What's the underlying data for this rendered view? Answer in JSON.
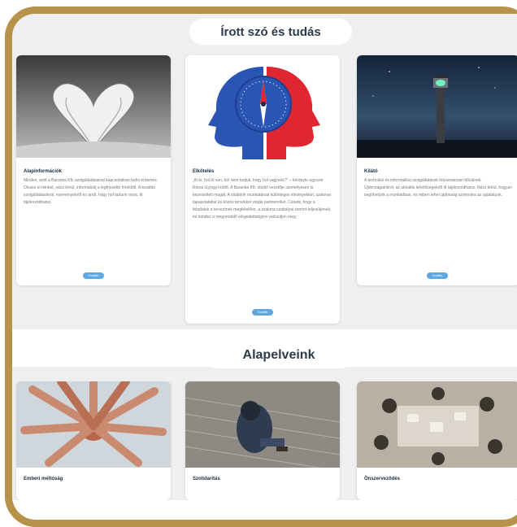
{
  "header": {
    "title": "Írott szó és tudás"
  },
  "cards": [
    {
      "title": "Alapinformációk",
      "text": "Minden, amit a Baranka Kft. szolgáltatásaival kapcsolatban tudni érdemes. Olvass el minket, nézz körül, informálódj a legfrissebb hírekből. A korábbi szolgáltatásokról, eseményekről és arról, hogy hol tartunk most, itt tájékozódhatsz.",
      "button": "Tovább"
    },
    {
      "title": "Elkötelés",
      "text": "„Itt ér, hol tű van, hol nem tudjuk, hogy hol vagyunk?” – kérdezte egyszer Rónai Györgyi költő. A Baranka Kft. stúdió vezetője személyesen is képviselteti magát. A stúdiónk munkatársai különleges élményekkel, szakmai tapasztalattal és közös tervekkel várják partnereiket. Célunk, hogy a feladatok a terveztnek megfelelően, a szakma szabályai szerint teljesüljenek, és mindez a megrendelő elégedettségére valósuljon meg.",
      "button": "Tovább"
    },
    {
      "title": "Kilátó",
      "text": "A technikai és informatikai szolgáltatások folyamatosan bővülnek. Újdonságainkról, az aktuális lehetőségekről itt tájékozódhatsz. Nézz körül, hogyan segíthetünk a munkádban, és miben lehet újdonság számodra az ajánlatunk.",
      "button": "Tovább"
    }
  ],
  "section2": {
    "title": "Alapelveink"
  },
  "cards2": [
    {
      "title": "Emberi méltóság"
    },
    {
      "title": "Szolidaritás"
    },
    {
      "title": "Önszerveződés"
    }
  ],
  "colors": {
    "gold": "#b6924a",
    "button": "#5fa8df",
    "brain_blue": "#2b55b3",
    "brain_red": "#e02630"
  }
}
